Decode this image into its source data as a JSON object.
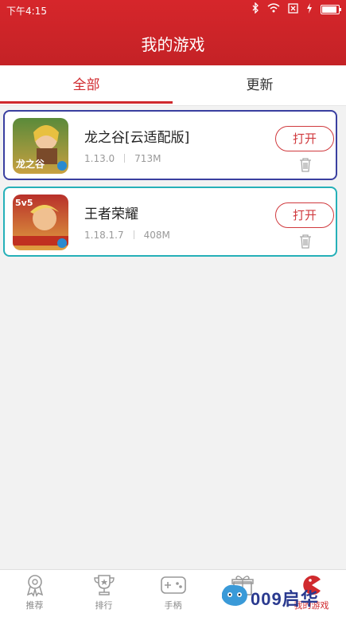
{
  "status_bar": {
    "time": "下午4:15",
    "battery_level": 0.9
  },
  "header": {
    "title": "我的游戏"
  },
  "tabs": [
    {
      "label": "全部",
      "active": true
    },
    {
      "label": "更新",
      "active": false
    }
  ],
  "games": [
    {
      "name": "龙之谷[云适配版]",
      "version": "1.13.0",
      "size": "713M",
      "open_label": "打开",
      "icon": "dragon-nest-game-icon",
      "border_color": "#3a3fa0"
    },
    {
      "name": "王者荣耀",
      "version": "1.18.1.7",
      "size": "408M",
      "open_label": "打开",
      "icon": "honor-of-kings-game-icon",
      "border_color": "#25b0b8"
    }
  ],
  "bottom_nav": [
    {
      "label": "推荐",
      "icon": "medal-icon",
      "active": false
    },
    {
      "label": "排行",
      "icon": "trophy-icon",
      "active": false
    },
    {
      "label": "手柄",
      "icon": "gamepad-icon",
      "active": false
    },
    {
      "label": "",
      "icon": "gift-icon",
      "active": false
    },
    {
      "label": "我的游戏",
      "icon": "pacman-icon",
      "active": true
    }
  ],
  "watermark": {
    "text": "009启华"
  },
  "colors": {
    "brand_red": "#d02a2e",
    "text_dark": "#222222",
    "text_gray": "#999999"
  }
}
